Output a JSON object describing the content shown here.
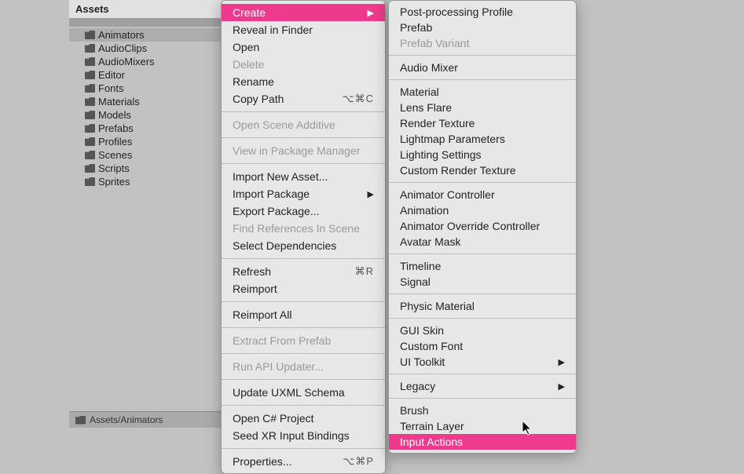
{
  "assets": {
    "header": "Assets",
    "items": [
      {
        "label": "Animators",
        "selected": true
      },
      {
        "label": "AudioClips"
      },
      {
        "label": "AudioMixers"
      },
      {
        "label": "Editor"
      },
      {
        "label": "Fonts"
      },
      {
        "label": "Materials"
      },
      {
        "label": "Models"
      },
      {
        "label": "Prefabs"
      },
      {
        "label": "Profiles"
      },
      {
        "label": "Scenes"
      },
      {
        "label": "Scripts"
      },
      {
        "label": "Sprites"
      }
    ],
    "breadcrumb": "Assets/Animators"
  },
  "contextMenu": {
    "sections": [
      [
        {
          "label": "Create",
          "submenu": true,
          "highlighted": true
        },
        {
          "label": "Reveal in Finder"
        },
        {
          "label": "Open"
        },
        {
          "label": "Delete",
          "disabled": true
        },
        {
          "label": "Rename"
        },
        {
          "label": "Copy Path",
          "shortcut": "⌥⌘C"
        }
      ],
      [
        {
          "label": "Open Scene Additive",
          "disabled": true
        }
      ],
      [
        {
          "label": "View in Package Manager",
          "disabled": true
        }
      ],
      [
        {
          "label": "Import New Asset..."
        },
        {
          "label": "Import Package",
          "submenu": true
        },
        {
          "label": "Export Package..."
        },
        {
          "label": "Find References In Scene",
          "disabled": true
        },
        {
          "label": "Select Dependencies"
        }
      ],
      [
        {
          "label": "Refresh",
          "shortcut": "⌘R"
        },
        {
          "label": "Reimport"
        }
      ],
      [
        {
          "label": "Reimport All"
        }
      ],
      [
        {
          "label": "Extract From Prefab",
          "disabled": true
        }
      ],
      [
        {
          "label": "Run API Updater...",
          "disabled": true
        }
      ],
      [
        {
          "label": "Update UXML Schema"
        }
      ],
      [
        {
          "label": "Open C# Project"
        },
        {
          "label": "Seed XR Input Bindings"
        }
      ],
      [
        {
          "label": "Properties...",
          "shortcut": "⌥⌘P"
        }
      ]
    ]
  },
  "submenu": {
    "sections": [
      [
        {
          "label": "Post-processing Profile"
        },
        {
          "label": "Prefab"
        },
        {
          "label": "Prefab Variant",
          "disabled": true
        }
      ],
      [
        {
          "label": "Audio Mixer"
        }
      ],
      [
        {
          "label": "Material"
        },
        {
          "label": "Lens Flare"
        },
        {
          "label": "Render Texture"
        },
        {
          "label": "Lightmap Parameters"
        },
        {
          "label": "Lighting Settings"
        },
        {
          "label": "Custom Render Texture"
        }
      ],
      [
        {
          "label": "Animator Controller"
        },
        {
          "label": "Animation"
        },
        {
          "label": "Animator Override Controller"
        },
        {
          "label": "Avatar Mask"
        }
      ],
      [
        {
          "label": "Timeline"
        },
        {
          "label": "Signal"
        }
      ],
      [
        {
          "label": "Physic Material"
        }
      ],
      [
        {
          "label": "GUI Skin"
        },
        {
          "label": "Custom Font"
        },
        {
          "label": "UI Toolkit",
          "submenu": true
        }
      ],
      [
        {
          "label": "Legacy",
          "submenu": true
        }
      ],
      [
        {
          "label": "Brush"
        },
        {
          "label": "Terrain Layer"
        },
        {
          "label": "Input Actions",
          "highlighted": true
        }
      ]
    ]
  }
}
